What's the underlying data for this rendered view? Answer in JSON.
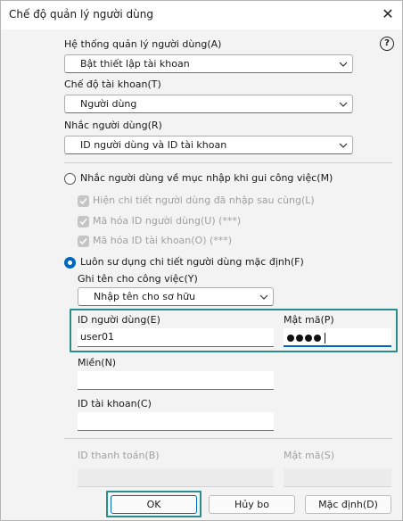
{
  "window": {
    "title": "Chế độ quản lý người dùng",
    "help_glyph": "?"
  },
  "system": {
    "label": "Hệ thống quản lý người dùng(A)",
    "value": "Bật thiết lập tài khoan"
  },
  "account_mode": {
    "label": "Chế độ tài khoan(T)",
    "value": "Người dùng"
  },
  "remember": {
    "label": "Nhắc người dùng(R)",
    "value": "ID người dùng và ID tài khoan"
  },
  "prompt_option": {
    "label": "Nhắc người dùng về mục nhập khi gui công việc(M)",
    "checks": [
      "Hiện chi tiết người dùng đã nhập sau cùng(L)",
      "Mã hóa ID người dùng(U) (***)",
      "Mã hóa ID tài khoan(O) (***)"
    ]
  },
  "default_option": {
    "label": "Luôn sư dụng chi tiết người dùng mặc định(F)",
    "job_name_label": "Ghi tên cho công việc(Y)",
    "job_name_value": "Nhập tên cho sơ hữu"
  },
  "fields": {
    "user_id_label": "ID người dùng(E)",
    "user_id_value": "user01",
    "password_label": "Mật mã(P)",
    "name_label": "Miền(N)",
    "name_value": "",
    "account_id_label": "ID tài khoan(C)",
    "account_id_value": "",
    "billing_id_label": "ID thanh toán(B)",
    "billing_pw_label": "Mật mã(S)"
  },
  "buttons": {
    "ok": "OK",
    "cancel": "Hủy bo",
    "default": "Mặc định(D)"
  },
  "colors": {
    "accent": "#0067c0",
    "highlight": "#2b8c8c"
  }
}
